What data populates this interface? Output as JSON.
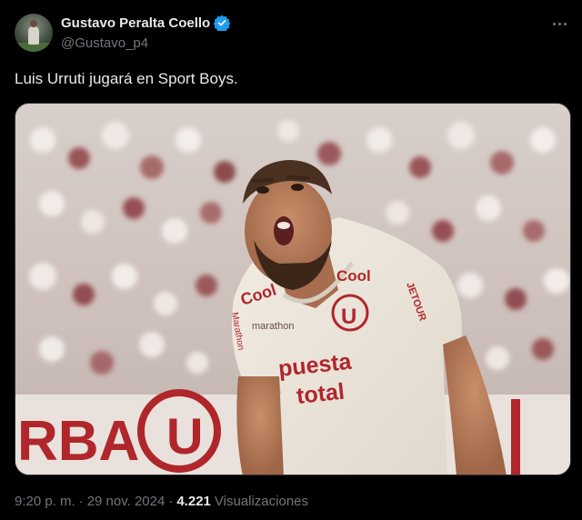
{
  "author": {
    "display_name": "Gustavo Peralta Coello",
    "handle": "@Gustavo_p4",
    "verified": true,
    "verified_color": "#1d9bf0"
  },
  "tweet": {
    "text": "Luis Urruti jugará en Sport Boys."
  },
  "media": {
    "jersey_text": {
      "sponsor_left": "Cool",
      "sponsor_right": "Cool",
      "sleeve_left": "Marathon",
      "sleeve_right": "JETOUR",
      "brand_chest": "marathon",
      "crest": "U",
      "main_sponsor_line1": "puesta",
      "main_sponsor_line2": "total",
      "banner_text": "RBA"
    }
  },
  "meta": {
    "time": "9:20 p. m.",
    "separator1": "·",
    "date": "29 nov. 2024",
    "separator2": "·",
    "views_count": "4.221",
    "views_label": "Visualizaciones"
  },
  "icons": {
    "more": "more-dots-icon",
    "verified": "verified-badge-icon"
  },
  "colors": {
    "background": "#000000",
    "text_primary": "#e7e9ea",
    "text_secondary": "#71767b",
    "jersey_red": "#b0262b"
  }
}
